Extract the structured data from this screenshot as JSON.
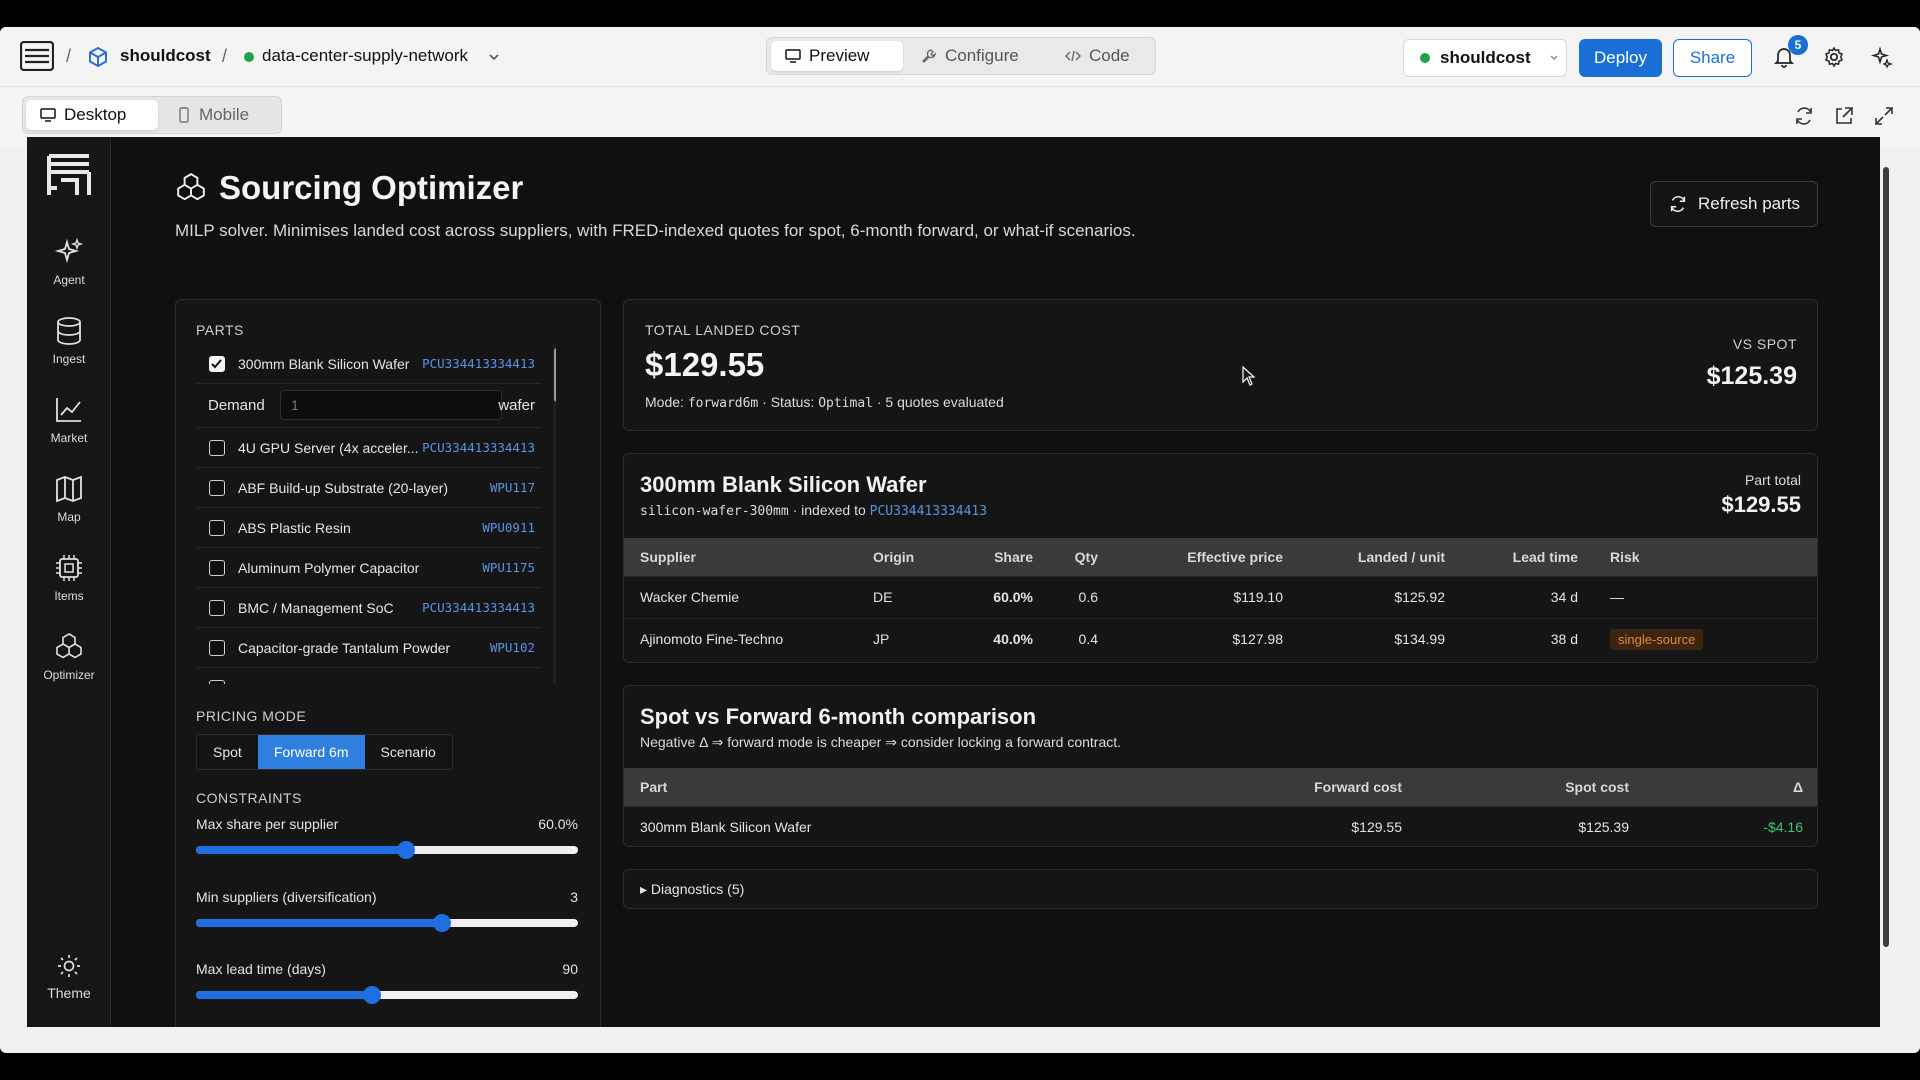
{
  "topbar": {
    "crumb_org": "shouldcost",
    "crumb_project": "data-center-supply-network",
    "tabs": [
      {
        "label": "Preview"
      },
      {
        "label": "Configure"
      },
      {
        "label": "Code"
      }
    ],
    "account_name": "shouldcost",
    "deploy_label": "Deploy",
    "share_label": "Share",
    "notification_count": "5"
  },
  "devicebar": {
    "tabs": [
      {
        "label": "Desktop"
      },
      {
        "label": "Mobile"
      }
    ]
  },
  "rail": {
    "items": [
      {
        "label": "Agent"
      },
      {
        "label": "Ingest"
      },
      {
        "label": "Market"
      },
      {
        "label": "Map"
      },
      {
        "label": "Items"
      },
      {
        "label": "Optimizer"
      }
    ],
    "theme_label": "Theme"
  },
  "page": {
    "title": "Sourcing Optimizer",
    "subtitle": "MILP solver. Minimises landed cost across suppliers, with FRED-indexed quotes for spot, 6-month forward, or what-if scenarios.",
    "refresh_label": "Refresh parts"
  },
  "parts": {
    "label": "PARTS",
    "demand_label": "Demand",
    "demand_placeholder": "1",
    "demand_unit": "wafer",
    "items": [
      {
        "name": "300mm Blank Silicon Wafer",
        "code": "PCU334413334413",
        "checked": true
      },
      {
        "name": "4U GPU Server (4x acceler...",
        "code": "PCU334413334413",
        "checked": false
      },
      {
        "name": "ABF Build-up Substrate (20-layer)",
        "code": "WPU117",
        "checked": false
      },
      {
        "name": "ABS Plastic Resin",
        "code": "WPU0911",
        "checked": false
      },
      {
        "name": "Aluminum Polymer Capacitor",
        "code": "WPU1175",
        "checked": false
      },
      {
        "name": "BMC / Management SoC",
        "code": "PCU334413334413",
        "checked": false
      },
      {
        "name": "Capacitor-grade Tantalum Powder",
        "code": "WPU102",
        "checked": false
      }
    ]
  },
  "pricing": {
    "label": "PRICING MODE",
    "modes": [
      {
        "label": "Spot",
        "active": false
      },
      {
        "label": "Forward 6m",
        "active": true
      },
      {
        "label": "Scenario",
        "active": false
      }
    ]
  },
  "constraints": {
    "label": "CONSTRAINTS",
    "sliders": [
      {
        "label": "Max share per supplier",
        "value": "60.0%",
        "fraction": 0.55
      },
      {
        "label": "Min suppliers (diversification)",
        "value": "3",
        "fraction": 0.645
      },
      {
        "label": "Max lead time (days)",
        "value": "90",
        "fraction": 0.46
      }
    ]
  },
  "summary": {
    "label": "TOTAL LANDED COST",
    "total": "$129.55",
    "mode_prefix": "Mode: ",
    "mode_value": "forward6m",
    "status_prefix": " · Status: ",
    "status_value": "Optimal",
    "quotes_text": " · 5 quotes evaluated",
    "vs_label": "VS SPOT",
    "vs_value": "$125.39"
  },
  "part_detail": {
    "name": "300mm Blank Silicon Wafer",
    "slug": "silicon-wafer-300mm",
    "indexed_prefix": " · indexed to ",
    "indexed_code": "PCU334413334413",
    "total_label": "Part total",
    "total_value": "$129.55",
    "columns": [
      "Supplier",
      "Origin",
      "Share",
      "Qty",
      "Effective price",
      "Landed / unit",
      "Lead time",
      "Risk"
    ],
    "rows": [
      {
        "supplier": "Wacker Chemie",
        "origin": "DE",
        "share": "60.0%",
        "qty": "0.6",
        "price": "$119.10",
        "landed": "$125.92",
        "lead": "34 d",
        "risk": "—",
        "risk_tag": false
      },
      {
        "supplier": "Ajinomoto Fine-Techno",
        "origin": "JP",
        "share": "40.0%",
        "qty": "0.4",
        "price": "$127.98",
        "landed": "$134.99",
        "lead": "38 d",
        "risk": "single-source",
        "risk_tag": true
      }
    ]
  },
  "comparison": {
    "title": "Spot vs Forward 6-month comparison",
    "note": "Negative Δ ⇒ forward mode is cheaper ⇒ consider locking a forward contract.",
    "columns": [
      "Part",
      "Forward cost",
      "Spot cost",
      "Δ"
    ],
    "rows": [
      {
        "part": "300mm Blank Silicon Wafer",
        "forward": "$129.55",
        "spot": "$125.39",
        "delta": "-$4.16"
      }
    ]
  },
  "diagnostics": {
    "label": "▸ Diagnostics (5)"
  },
  "colors": {
    "accent": "#1a6fd6",
    "status_green": "#1fa34a",
    "delta_green": "#3ec47a",
    "risk_orange": "#e48a36"
  }
}
